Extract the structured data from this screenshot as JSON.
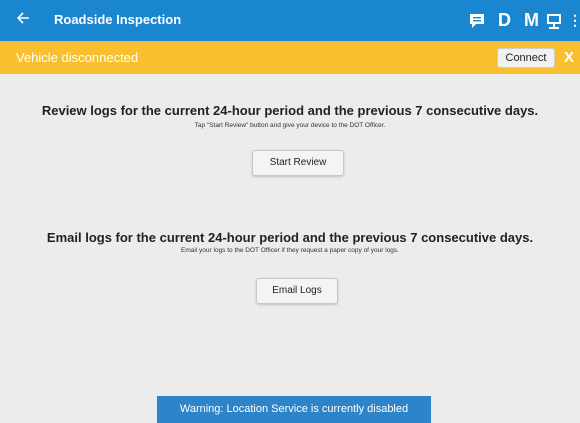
{
  "header": {
    "back_icon": "arrow-left",
    "title": "Roadside Inspection",
    "icons": [
      "chat-icon",
      "d-icon",
      "m-icon",
      "monitor-icon",
      "more-icon"
    ],
    "d_label": "D",
    "m_label": "M",
    "more_label": "⋮",
    "color": "#1a86cf"
  },
  "status_bar": {
    "text": "Vehicle disconnected",
    "connect_label": "Connect",
    "close_label": "X",
    "color": "#f8c02f"
  },
  "review": {
    "heading": "Review logs for the current 24-hour period and the previous 7 consecutive days.",
    "subtext": "Tap \"Start Review\" button and give your device to the DOT Officer.",
    "button_label": "Start Review"
  },
  "email": {
    "heading": "Email logs for the current 24-hour period and the previous 7 consecutive days.",
    "subtext": "Email your logs to the DOT Officer if they request a paper copy of your logs.",
    "button_label": "Email Logs"
  },
  "toast": {
    "text": "Warning: Location Service is currently disabled",
    "color": "#2d84c8"
  }
}
